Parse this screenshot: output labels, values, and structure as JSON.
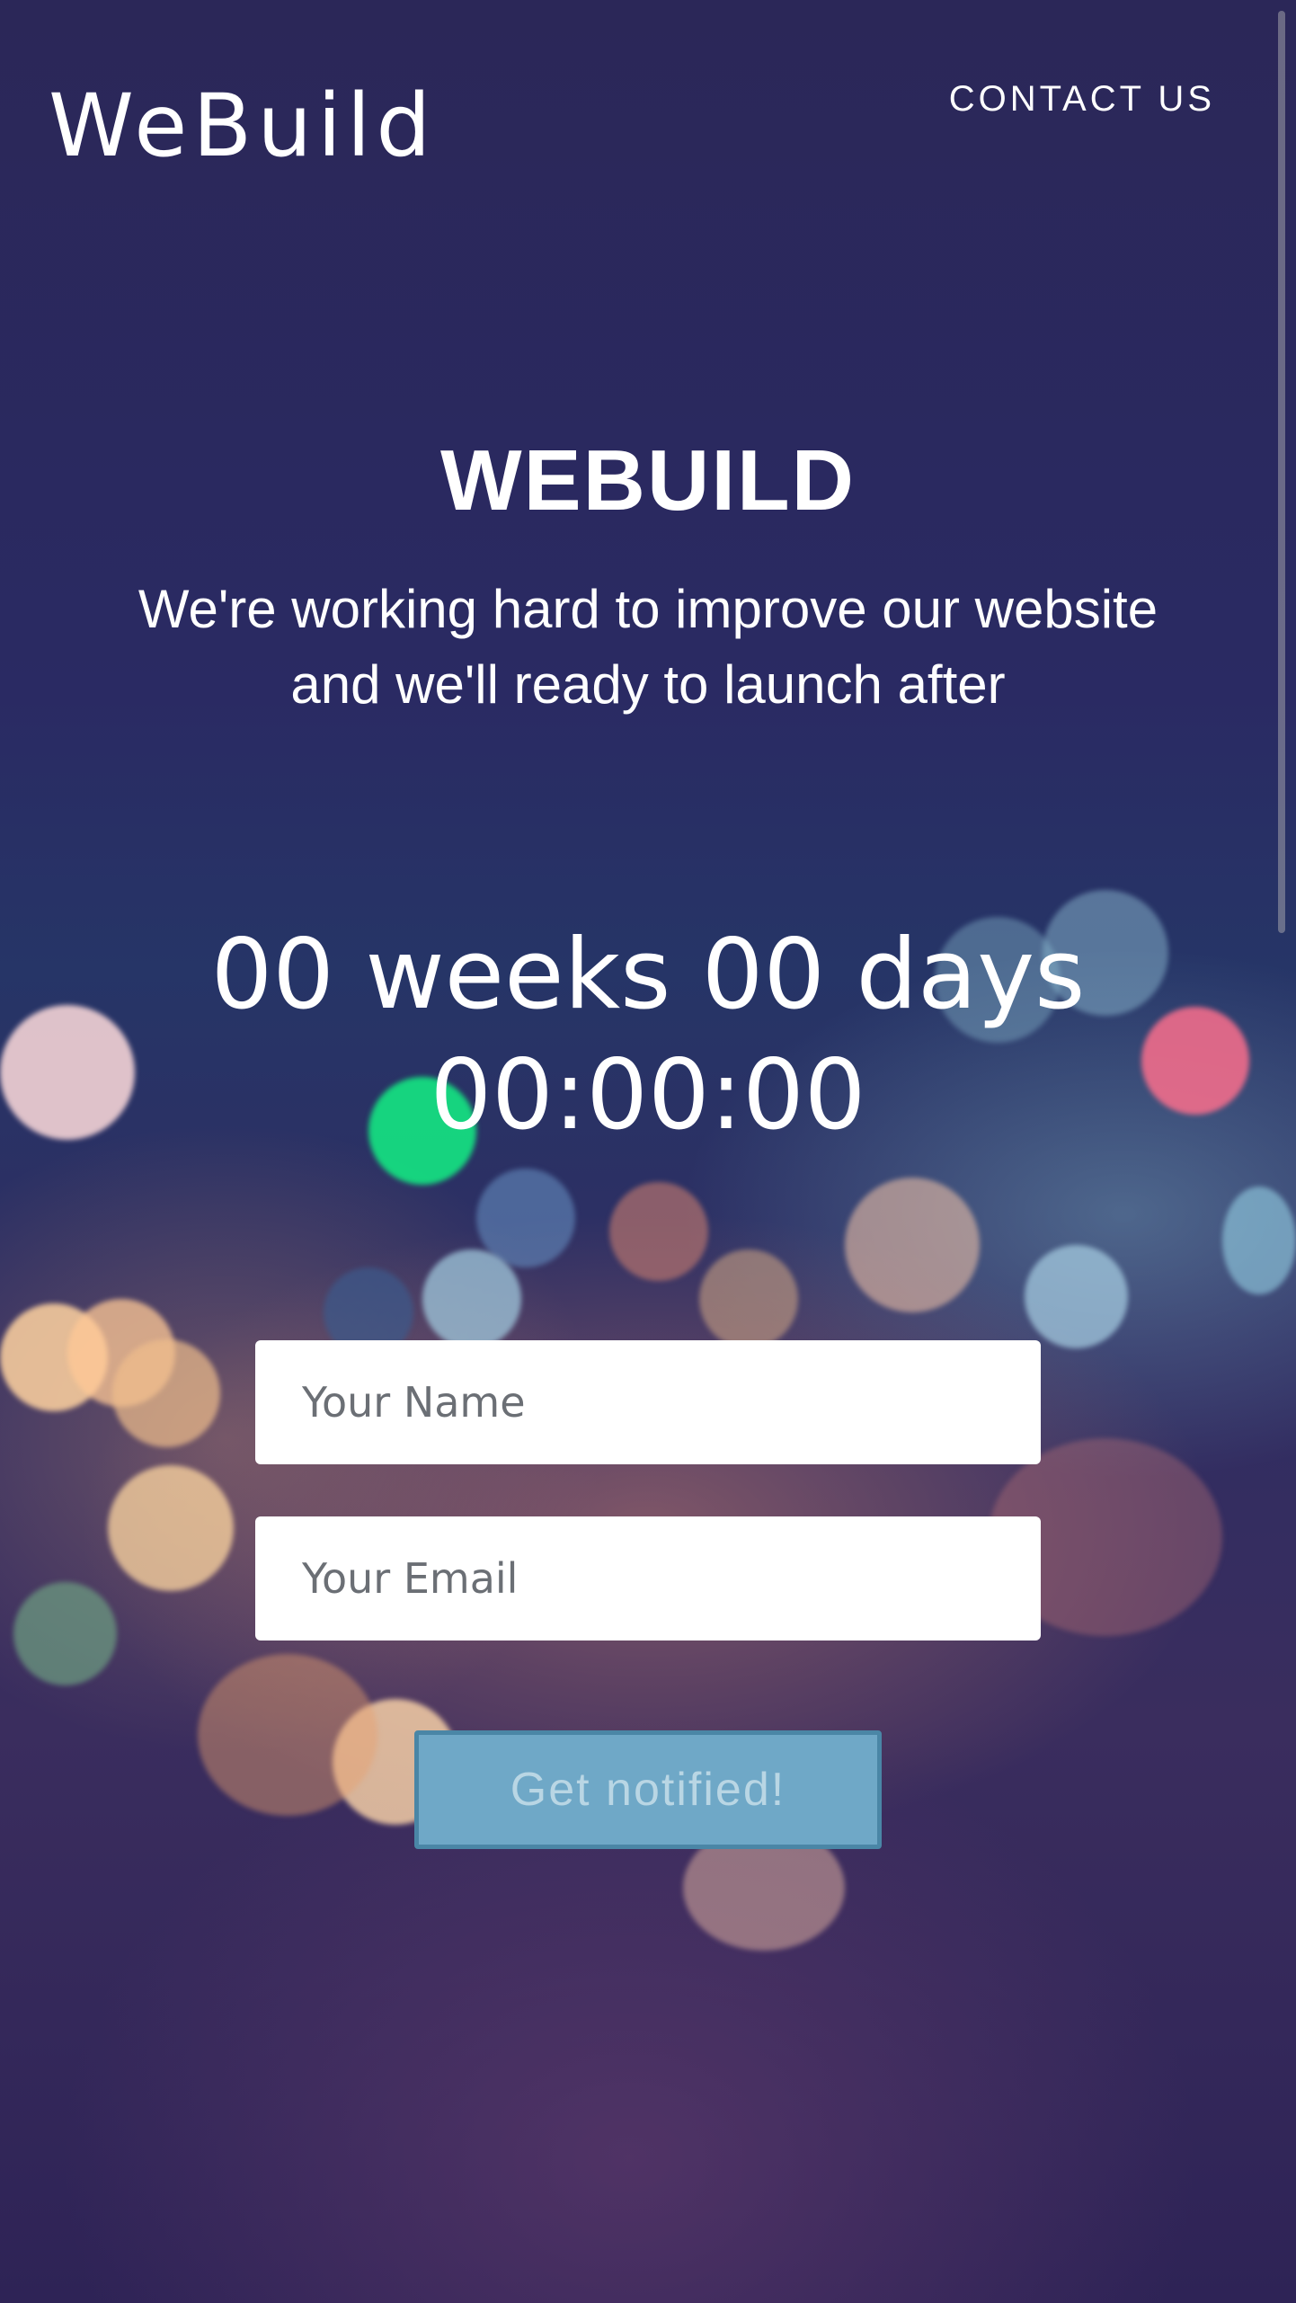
{
  "header": {
    "logo": "WeBuild",
    "nav_link": "CONTACT US"
  },
  "hero": {
    "title": "WEBUILD",
    "subtitle_line1": "We're working hard to improve our website",
    "subtitle_line2": "and we'll ready to launch after"
  },
  "countdown": {
    "line1": "00 weeks 00 days",
    "line2": "00:00:00"
  },
  "form": {
    "name_placeholder": "Your Name",
    "email_placeholder": "Your Email",
    "submit_label": "Get notified!"
  },
  "colors": {
    "background": "#2b2557",
    "button": "#6fa8c7",
    "button_border": "#4a86a6",
    "text": "#ffffff"
  }
}
